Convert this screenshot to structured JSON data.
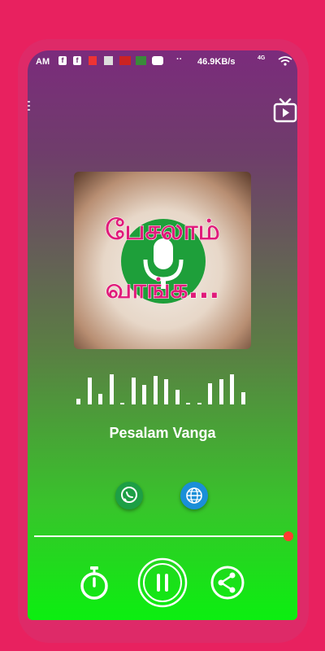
{
  "status_bar": {
    "time": "AM",
    "network_speed": "46.9KB/s",
    "signal": "4G"
  },
  "artwork": {
    "line1": "பேசலாம்",
    "line2": "வாங்க...",
    "alt": "Pesalam Vanga logo"
  },
  "equalizer": {
    "levels": [
      0.15,
      0.75,
      0.3,
      0.85,
      0.05,
      0.75,
      0.55,
      0.8,
      0.7,
      0.4,
      0.05,
      0.05,
      0.6,
      0.7,
      0.85,
      0.35
    ]
  },
  "station": {
    "name": "Pesalam Vanga"
  },
  "playback": {
    "progress": 0.99,
    "state": "playing"
  },
  "icons": [
    "facebook-icon",
    "whatsapp-icon",
    "globe-icon",
    "tv-icon",
    "timer-icon",
    "pause-icon",
    "share-icon"
  ],
  "colors": {
    "accent": "#e8215f",
    "gradient_top": "#7b2b7c",
    "gradient_bottom": "#0bef10",
    "seek_knob": "#ff3b30"
  }
}
